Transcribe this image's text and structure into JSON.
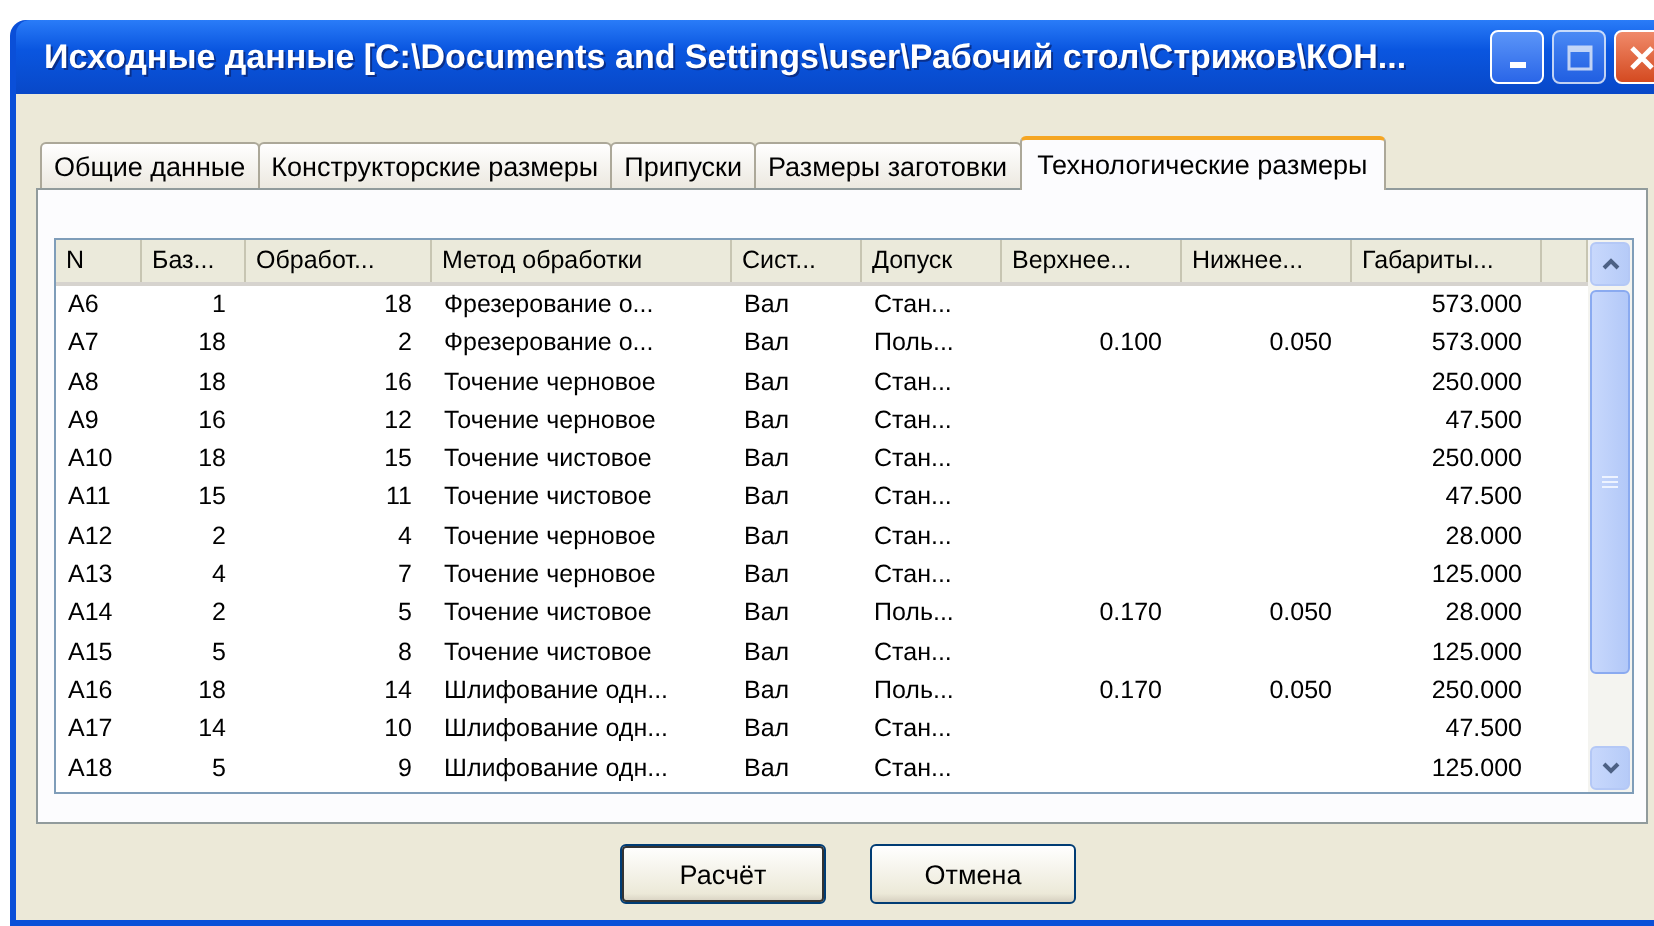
{
  "window": {
    "title": "Исходные данные [C:\\Documents and Settings\\user\\Рабочий стол\\Стрижов\\КОН..."
  },
  "tabs": [
    {
      "label": "Общие данные",
      "selected": false
    },
    {
      "label": "Конструкторские размеры",
      "selected": false
    },
    {
      "label": "Припуски",
      "selected": false
    },
    {
      "label": "Размеры заготовки",
      "selected": false
    },
    {
      "label": "Технологические размеры",
      "selected": true
    }
  ],
  "table": {
    "columns": [
      "N",
      "Баз...",
      "Обработ...",
      "Метод обработки",
      "Сист...",
      "Допуск",
      "Верхнее...",
      "Нижнее...",
      "Габариты..."
    ],
    "rows": [
      [
        "A6",
        "1",
        "18",
        "Фрезерование о...",
        "Вал",
        "Стан...",
        null,
        null,
        "573.000"
      ],
      [
        "A7",
        "18",
        "2",
        "Фрезерование о...",
        "Вал",
        "Поль...",
        "0.100",
        "0.050",
        "573.000"
      ],
      [
        "A8",
        "18",
        "16",
        "Точение черновое",
        "Вал",
        "Стан...",
        null,
        null,
        "250.000"
      ],
      [
        "A9",
        "16",
        "12",
        "Точение черновое",
        "Вал",
        "Стан...",
        null,
        null,
        "47.500"
      ],
      [
        "A10",
        "18",
        "15",
        "Точение чистовое",
        "Вал",
        "Стан...",
        null,
        null,
        "250.000"
      ],
      [
        "A11",
        "15",
        "11",
        "Точение чистовое",
        "Вал",
        "Стан...",
        null,
        null,
        "47.500"
      ],
      [
        "A12",
        "2",
        "4",
        "Точение черновое",
        "Вал",
        "Стан...",
        null,
        null,
        "28.000"
      ],
      [
        "A13",
        "4",
        "7",
        "Точение черновое",
        "Вал",
        "Стан...",
        null,
        null,
        "125.000"
      ],
      [
        "A14",
        "2",
        "5",
        "Точение чистовое",
        "Вал",
        "Поль...",
        "0.170",
        "0.050",
        "28.000"
      ],
      [
        "A15",
        "5",
        "8",
        "Точение чистовое",
        "Вал",
        "Стан...",
        null,
        null,
        "125.000"
      ],
      [
        "A16",
        "18",
        "14",
        "Шлифование одн...",
        "Вал",
        "Поль...",
        "0.170",
        "0.050",
        "250.000"
      ],
      [
        "A17",
        "14",
        "10",
        "Шлифование одн...",
        "Вал",
        "Стан...",
        null,
        null,
        "47.500"
      ],
      [
        "A18",
        "5",
        "9",
        "Шлифование одн...",
        "Вал",
        "Стан...",
        null,
        null,
        "125.000"
      ]
    ]
  },
  "buttons": [
    {
      "label": "Расчёт",
      "default": true
    },
    {
      "label": "Отмена",
      "default": false
    }
  ]
}
